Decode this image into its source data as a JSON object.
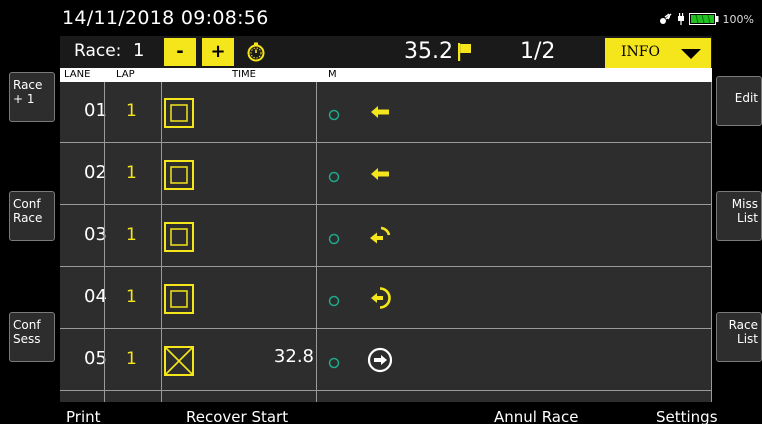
{
  "status_bar": {
    "datetime": "14/11/2018  09:08:56",
    "battery_percent": "100%",
    "icons": [
      "satellite-icon",
      "plug-icon",
      "battery-icon"
    ]
  },
  "race_header": {
    "race_label": "Race:",
    "race_number": "1",
    "minus_label": "-",
    "plus_label": "+",
    "race_time": "35.2",
    "lap_fraction": "1/2",
    "info_label": "INFO",
    "icons": [
      "stopwatch-icon",
      "flag-icon",
      "caret-down-icon"
    ]
  },
  "columns": {
    "lane": "LANE",
    "lap": "LAP",
    "time": "TIME",
    "m": "M"
  },
  "rows": [
    {
      "lane": "01",
      "lap": "1",
      "time": "",
      "time_icon": "square-icon",
      "m_icon": "circle-icon",
      "status_icon": "arrow-left-icon"
    },
    {
      "lane": "02",
      "lap": "1",
      "time": "",
      "time_icon": "square-icon",
      "m_icon": "circle-icon",
      "status_icon": "arrow-left-icon"
    },
    {
      "lane": "03",
      "lap": "1",
      "time": "",
      "time_icon": "square-icon",
      "m_icon": "circle-icon",
      "status_icon": "arrow-turn-half-icon"
    },
    {
      "lane": "04",
      "lap": "1",
      "time": "",
      "time_icon": "square-icon",
      "m_icon": "circle-icon",
      "status_icon": "arrow-turn-full-icon"
    },
    {
      "lane": "05",
      "lap": "1",
      "time": "32.8",
      "time_icon": "crossed-square-icon",
      "m_icon": "circle-icon",
      "status_icon": "arrow-right-circle-icon"
    }
  ],
  "side_left": [
    {
      "line1": "Race",
      "line2": "+ 1"
    },
    {
      "line1": "Conf",
      "line2": "Race"
    },
    {
      "line1": "Conf",
      "line2": "Sess"
    }
  ],
  "side_right": [
    {
      "line1": "Edit",
      "line2": ""
    },
    {
      "line1": "Miss",
      "line2": "List"
    },
    {
      "line1": "Race",
      "line2": "List"
    }
  ],
  "bottom_bar": {
    "print": "Print",
    "recover_start": "Recover Start",
    "annul_race": "Annul Race",
    "settings": "Settings"
  },
  "colors": {
    "accent_yellow": "#f5e51b",
    "marker_teal": "#1fa88c",
    "panel": "#2d2d2d",
    "grid_line": "#9a9a9a",
    "battery_green": "#22c122"
  }
}
